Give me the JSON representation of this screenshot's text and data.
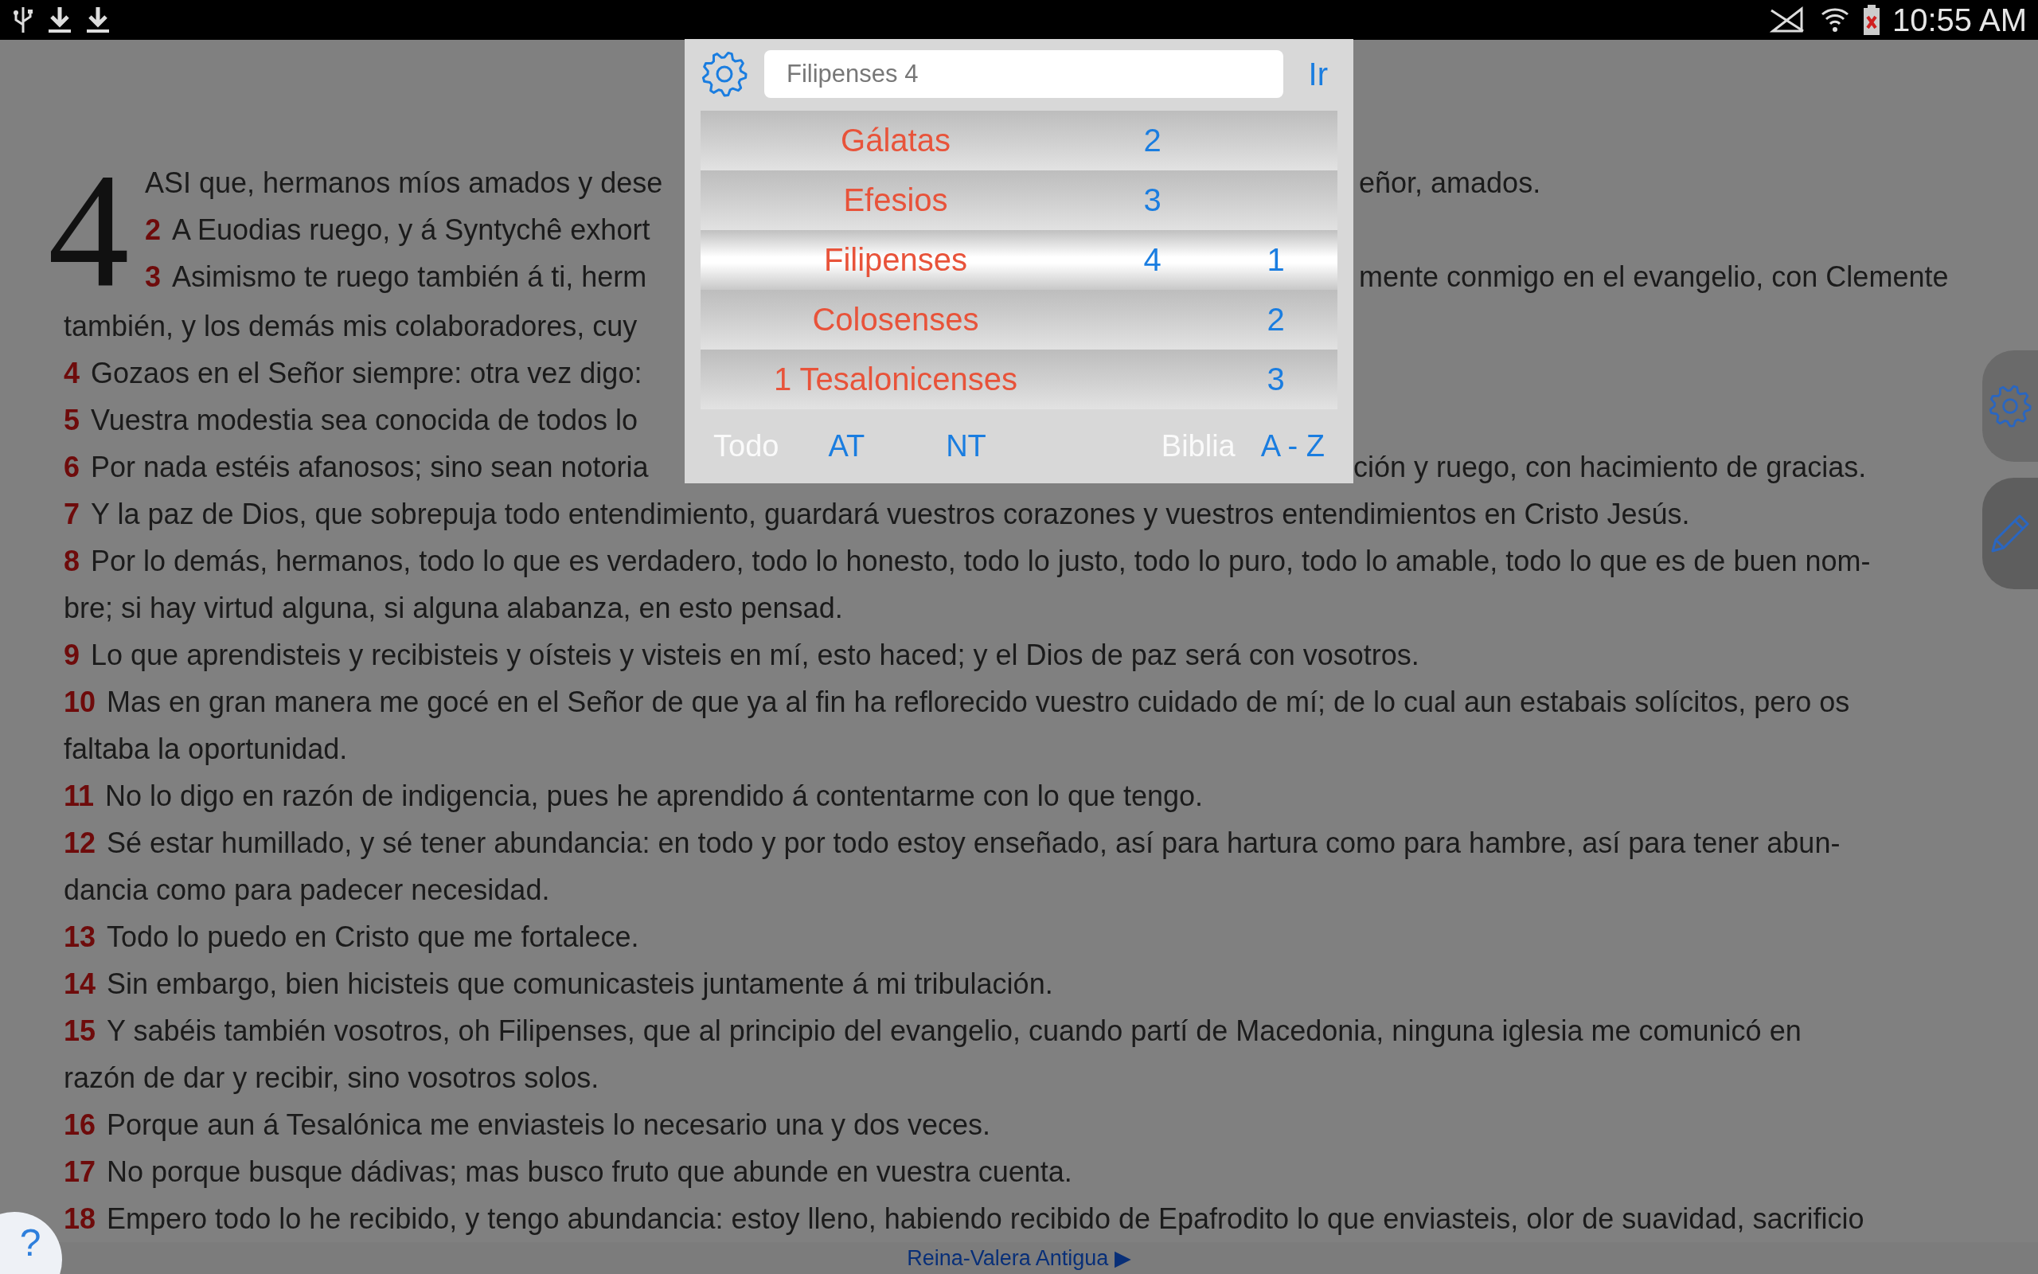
{
  "status_bar": {
    "time": "10:55 AM"
  },
  "reader": {
    "chapter_number": "4",
    "lines": [
      {
        "text": "ASI que, hermanos míos amados y dese",
        "tail": "eñor, amados."
      },
      {
        "number": "2",
        "text": "A Euodias ruego, y á Syntychê exhort"
      },
      {
        "number": "3",
        "text": "Asimismo te ruego también á ti, herm",
        "tail": "mente conmigo en el evangelio, con Clemente"
      },
      {
        "text": "también, y los demás mis colaboradores, cuy"
      },
      {
        "number": "4",
        "text": "Gozaos en el Señor siempre: otra vez digo:"
      },
      {
        "number": "5",
        "text": "Vuestra modestia sea conocida de todos lo"
      },
      {
        "number": "6",
        "text": "Por nada estéis afanosos; sino sean notoria",
        "tail": "ción y ruego, con hacimiento de gracias."
      },
      {
        "number": "7",
        "text": "Y la paz de Dios, que sobrepuja todo entendimiento, guardará vuestros corazones y vuestros entendimientos en Cristo Jesús."
      },
      {
        "number": "8",
        "text": "Por lo demás, hermanos, todo lo que es verdadero, todo lo honesto, todo lo justo, todo lo puro, todo lo amable, todo lo que es de buen nom-"
      },
      {
        "text": "bre; si hay virtud alguna, si alguna alabanza, en esto pensad."
      },
      {
        "number": "9",
        "text": "Lo que aprendisteis y recibisteis y oísteis y visteis en mí, esto haced; y el Dios de paz será con vosotros."
      },
      {
        "number": "10",
        "text": "Mas en gran manera me gocé en el Señor de que ya al fin ha reflorecido vuestro cuidado de mí; de lo cual aun estabais solícitos, pero os"
      },
      {
        "text": "faltaba la oportunidad."
      },
      {
        "number": "11",
        "text": "No lo digo en razón de indigencia, pues he aprendido á contentarme con lo que tengo."
      },
      {
        "number": "12",
        "text": "Sé estar humillado, y sé tener abundancia: en todo y por todo estoy enseñado, así para hartura como para hambre, así para tener abun-"
      },
      {
        "text": "dancia como para padecer necesidad."
      },
      {
        "number": "13",
        "text": "Todo lo puedo en Cristo que me fortalece."
      },
      {
        "number": "14",
        "text": "Sin embargo, bien hicisteis que comunicasteis juntamente á mi tribulación."
      },
      {
        "number": "15",
        "text": "Y sabéis también vosotros, oh Filipenses, que al principio del evangelio, cuando partí de Macedonia, ninguna iglesia me comunicó en"
      },
      {
        "text": "razón de dar y recibir, sino vosotros solos."
      },
      {
        "number": "16",
        "text": "Porque aun á Tesalónica me enviasteis lo necesario una y dos veces."
      },
      {
        "number": "17",
        "text": "No porque busque dádivas; mas busco fruto que abunde en vuestra cuenta."
      },
      {
        "number": "18",
        "text": "Empero todo lo he recibido, y tengo abundancia: estoy lleno, habiendo recibido de Epafrodito lo que enviasteis, olor de suavidad, sacrificio"
      }
    ]
  },
  "navigator": {
    "search": {
      "value": "Filipenses 4"
    },
    "go_button": "Ir",
    "rows": [
      {
        "book": "Gálatas",
        "chapter": "2",
        "selected": false
      },
      {
        "book": "Efesios",
        "chapter": "3",
        "selected": false
      },
      {
        "book": "Filipenses",
        "chapter": "4",
        "verse": "1",
        "selected": true
      },
      {
        "book": "Colosenses",
        "verse": "2",
        "selected": false
      },
      {
        "book": "1 Tesalonicenses",
        "verse": "3",
        "selected": false
      }
    ],
    "testament_filters": [
      {
        "label": "Todo",
        "selected": true
      },
      {
        "label": "AT",
        "selected": false
      },
      {
        "label": "NT",
        "selected": false
      }
    ],
    "sort_options": [
      {
        "label": "Biblia",
        "selected": true
      },
      {
        "label": "A - Z",
        "selected": false
      }
    ]
  },
  "help_button": "?",
  "footer": {
    "version": "Reina-Valera Antigua ▶"
  }
}
